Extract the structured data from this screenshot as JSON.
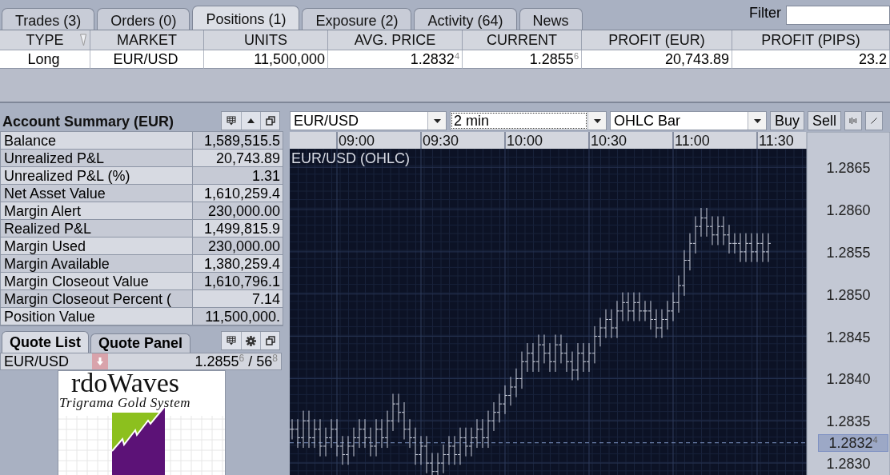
{
  "tabs": [
    {
      "label": "Trades (3)",
      "selected": false
    },
    {
      "label": "Orders (0)",
      "selected": false
    },
    {
      "label": "Positions (1)",
      "selected": true
    },
    {
      "label": "Exposure (2)",
      "selected": false
    },
    {
      "label": "Activity (64)",
      "selected": false
    },
    {
      "label": "News",
      "selected": false
    }
  ],
  "filter": {
    "label": "Filter"
  },
  "positions": {
    "columns": [
      "TYPE",
      "MARKET",
      "UNITS",
      "AVG. PRICE",
      "CURRENT",
      "PROFIT (EUR)",
      "PROFIT (PIPS)"
    ],
    "rows": [
      {
        "cells": [
          "Long",
          "EUR/USD",
          "11,500,000",
          "1.2832$^{4}$",
          "1.2855$^{6}$",
          "20,743.89",
          "23.2"
        ]
      }
    ]
  },
  "account_summary": {
    "title": "Account Summary (EUR)",
    "rows": [
      {
        "label": "Balance",
        "value": "1,589,515.5"
      },
      {
        "label": "Unrealized P&L",
        "value": "20,743.89"
      },
      {
        "label": "Unrealized P&L (%)",
        "value": "1.31"
      },
      {
        "label": "Net Asset Value",
        "value": "1,610,259.4"
      },
      {
        "label": "Margin Alert",
        "value": "230,000.00"
      },
      {
        "label": "Realized P&L",
        "value": "1,499,815.9"
      },
      {
        "label": "Margin Used",
        "value": "230,000.00"
      },
      {
        "label": "Margin Available",
        "value": "1,380,259.4"
      },
      {
        "label": "Margin Closeout Value",
        "value": "1,610,796.1"
      },
      {
        "label": "Margin Closeout Percent (",
        "value": "7.14"
      },
      {
        "label": "Position Value",
        "value": "11,500,000."
      }
    ]
  },
  "quote_tabs": [
    {
      "label": "Quote List",
      "selected": true
    },
    {
      "label": "Quote Panel",
      "selected": false
    }
  ],
  "quotes": [
    {
      "market": "EUR/USD",
      "price": "1.2855$^{6}$ / 56$^{8}$"
    }
  ],
  "banner": {
    "title": "rdoWaves",
    "subtitle": "Trigrama Gold System"
  },
  "chart_toolbar": {
    "selects": [
      {
        "value": "EUR/USD",
        "focused": false
      },
      {
        "value": "2 min",
        "focused": true
      },
      {
        "value": "OHLC Bar",
        "focused": false
      }
    ],
    "buttons": [
      "Buy",
      "Sell"
    ]
  },
  "chart": {
    "title": "EUR/USD (OHLC)",
    "current_price": "1.2832$^{4}$",
    "time_labels": [
      "09:00",
      "09:30",
      "10:00",
      "10:30",
      "11:00",
      "11:30"
    ],
    "price_labels": [
      "1.2865",
      "1.2860",
      "1.2855",
      "1.2850",
      "1.2845",
      "1.2840",
      "1.2835",
      "1.2830"
    ]
  }
}
